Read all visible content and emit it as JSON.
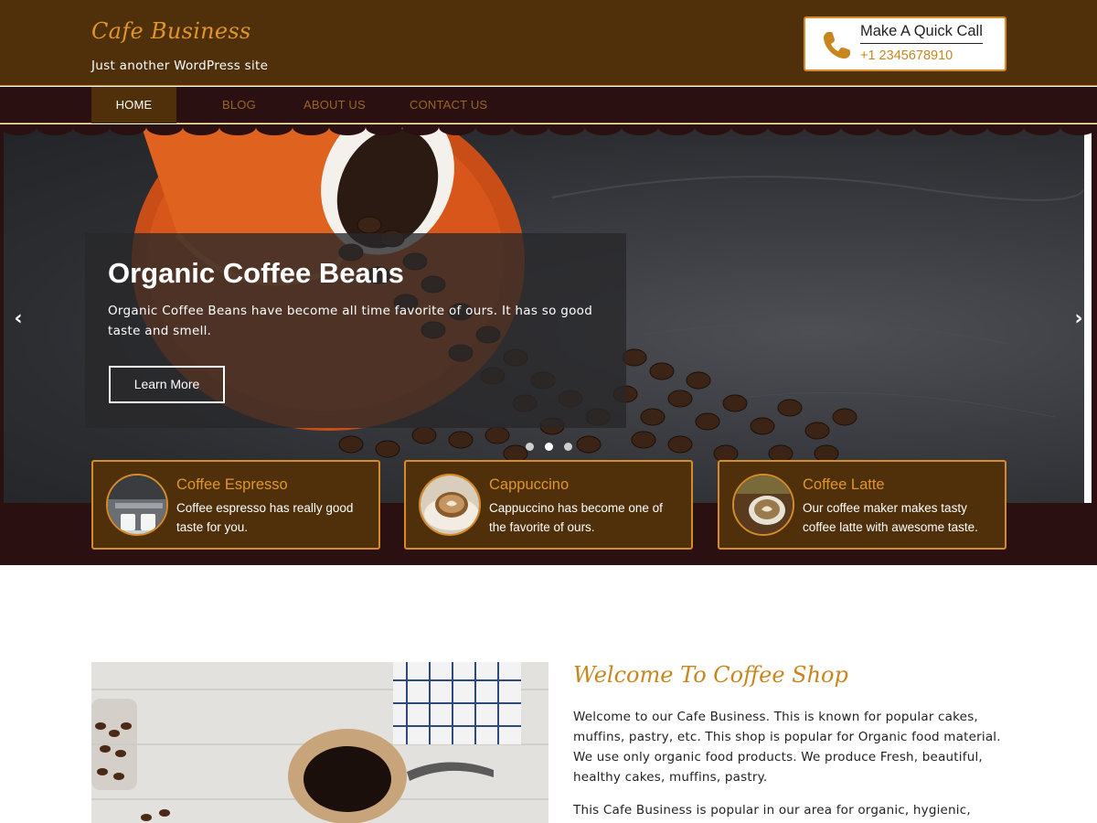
{
  "header": {
    "site_title": "Cafe Business",
    "tagline": "Just another WordPress site",
    "call": {
      "title": "Make A Quick Call",
      "number": "+1 2345678910",
      "icon": "phone-icon"
    }
  },
  "nav": {
    "items": [
      {
        "label": "HOME",
        "active": true
      },
      {
        "label": "BLOG",
        "active": false
      },
      {
        "label": "ABOUT US",
        "active": false
      },
      {
        "label": "CONTACT US",
        "active": false
      }
    ]
  },
  "slider": {
    "title": "Organic Coffee Beans",
    "text": "Organic Coffee Beans have become all time favorite of ours. It has so good taste and smell.",
    "button": "Learn More",
    "prev_icon": "chevron-left-icon",
    "next_icon": "chevron-right-icon",
    "dots": 3,
    "active_dot": 1
  },
  "features": [
    {
      "title": "Coffee Espresso",
      "text": "Coffee espresso has really good taste for you."
    },
    {
      "title": "Cappuccino",
      "text": "Cappuccino has become one of the favorite of ours."
    },
    {
      "title": "Coffee Latte",
      "text": "Our coffee maker makes tasty coffee latte with awesome taste."
    }
  ],
  "welcome": {
    "title": "Welcome To Coffee Shop",
    "p1": "Welcome to our Cafe Business. This is known for popular cakes, muffins, pastry, etc. This shop is popular for Organic food material. We use only organic food products. We produce Fresh, beautiful, healthy cakes, muffins, pastry.",
    "p2": "This Cafe Business is popular in our area for organic, hygienic,"
  },
  "colors": {
    "header_bg": "#4f300a",
    "nav_bg": "#2a1011",
    "accent": "#e0952b",
    "card_border": "#d48b2a"
  }
}
